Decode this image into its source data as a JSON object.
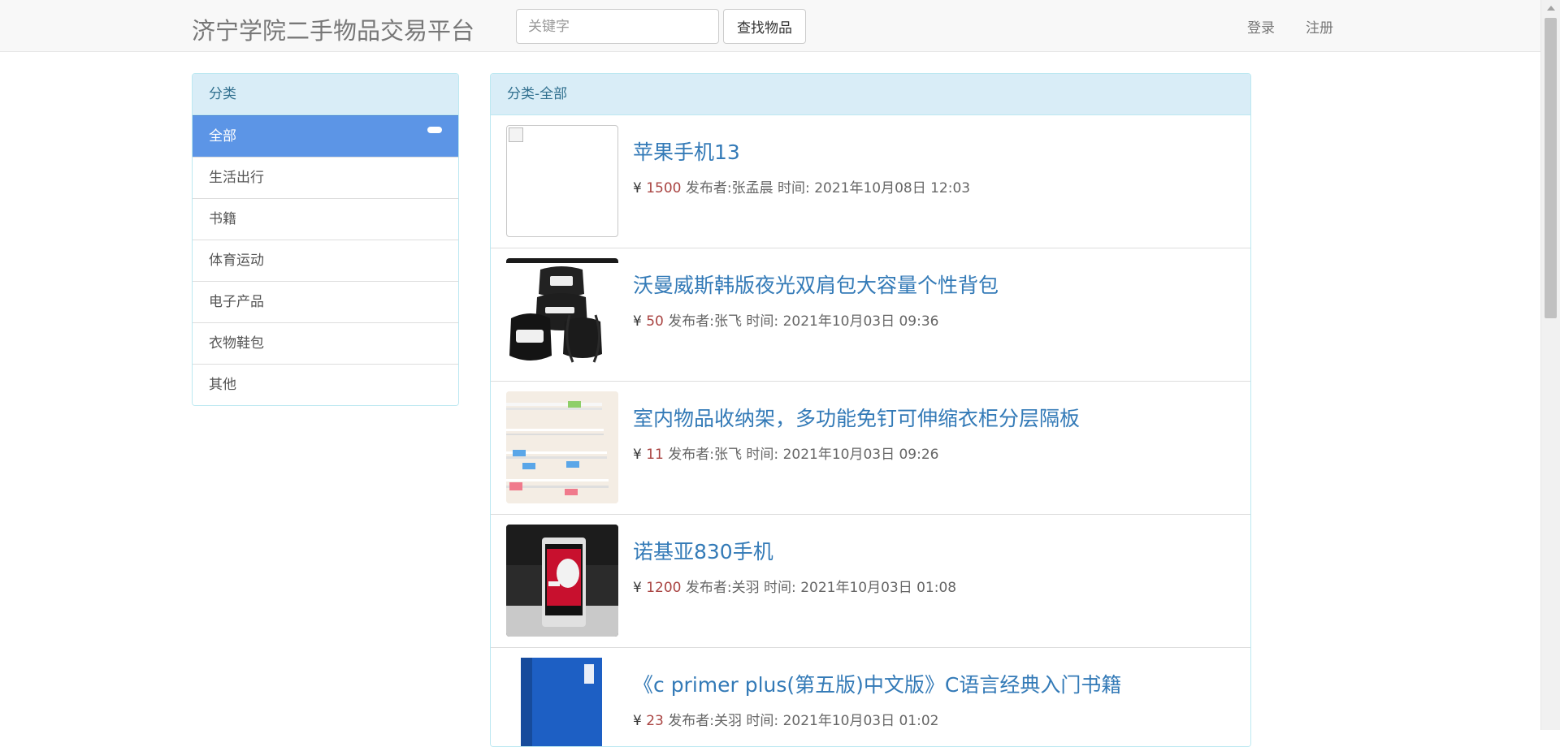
{
  "navbar": {
    "brand": "济宁学院二手物品交易平台",
    "search_placeholder": "关键字",
    "search_button": "查找物品",
    "login": "登录",
    "register": "注册"
  },
  "sidebar": {
    "title": "分类",
    "items": [
      {
        "label": "全部",
        "active": true
      },
      {
        "label": "生活出行"
      },
      {
        "label": "书籍"
      },
      {
        "label": "体育运动"
      },
      {
        "label": "电子产品"
      },
      {
        "label": "衣物鞋包"
      },
      {
        "label": "其他"
      }
    ]
  },
  "main": {
    "heading": "分类-全部",
    "items": [
      {
        "title": "苹果手机13",
        "currency": "¥",
        "price": "1500",
        "publisher": "发布者:张孟晨",
        "time_label": "时间:",
        "time": "2021年10月08日 12:03",
        "image": "broken-image"
      },
      {
        "title": "沃曼威斯韩版夜光双肩包大容量个性背包",
        "currency": "¥",
        "price": "50",
        "publisher": "发布者:张飞",
        "time_label": "时间:",
        "time": "2021年10月03日 09:36",
        "image": "backpack-photo"
      },
      {
        "title": "室内物品收纳架，多功能免钉可伸缩衣柜分层隔板",
        "currency": "¥",
        "price": "11",
        "publisher": "发布者:张飞",
        "time_label": "时间:",
        "time": "2021年10月03日 09:26",
        "image": "shelf-photo"
      },
      {
        "title": "诺基亚830手机",
        "currency": "¥",
        "price": "1200",
        "publisher": "发布者:关羽",
        "time_label": "时间:",
        "time": "2021年10月03日 01:08",
        "image": "phone-photo"
      },
      {
        "title": "《c primer plus(第五版)中文版》C语言经典入门书籍",
        "currency": "¥",
        "price": "23",
        "publisher": "发布者:关羽",
        "time_label": "时间:",
        "time": "2021年10月03日 01:02",
        "image": "book-photo"
      }
    ]
  },
  "colors": {
    "active_category": "#5c95e6",
    "panel_heading_bg": "#d9edf7",
    "link": "#337ab7",
    "price": "#a94442"
  }
}
